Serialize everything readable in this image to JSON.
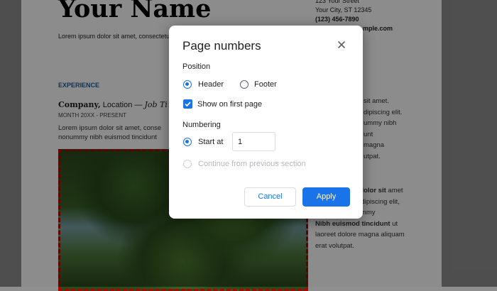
{
  "document": {
    "name": "Your Name",
    "tagline": "Lorem ipsum dolor sit amet, consectetur",
    "contact": {
      "street": "123 Your Street",
      "city": "Your City, ST 12345",
      "phone": "(123) 456-7890",
      "email": "mple.com"
    },
    "section_heading": "EXPERIENCE",
    "job": {
      "company": "Company,",
      "location": " Location — ",
      "title": "Job Ti"
    },
    "period": "MONTH 20XX - PRESENT",
    "description": "Lorem ipsum dolor sit amet, conse nonummy nibh euismod tincidunt",
    "right_column": {
      "line1": "sit amet.",
      "line2": "dipiscing elit.",
      "line3": "ummy nibh",
      "line4": "unt",
      "line5": "magna",
      "line6": "utpat.",
      "bold1": "Lorem ipsum dolor sit",
      "rest1": " amet",
      "line7": "Consectetuer adipiscing elit,",
      "line8": "Sed diam nonummy",
      "bold2": "Nibh euismod tincidunt",
      "rest2": " ut",
      "line9": "laoreet dolore magna aliquam",
      "line10": "erat volutpat."
    }
  },
  "dialog": {
    "title": "Page numbers",
    "position_label": "Position",
    "header_label": "Header",
    "footer_label": "Footer",
    "position_selected": "Header",
    "show_first_page_label": "Show on first page",
    "show_first_page_checked": true,
    "numbering_label": "Numbering",
    "start_at_label": "Start at",
    "start_at_value": "1",
    "continue_label": "Continue from previous section",
    "cancel_label": "Cancel",
    "apply_label": "Apply"
  },
  "colors": {
    "accent": "#1a73e8",
    "heading_blue": "#1d5d9b",
    "photo_border": "#b30000"
  },
  "icons": {
    "close": "close-icon",
    "check": "checkmark-icon"
  }
}
